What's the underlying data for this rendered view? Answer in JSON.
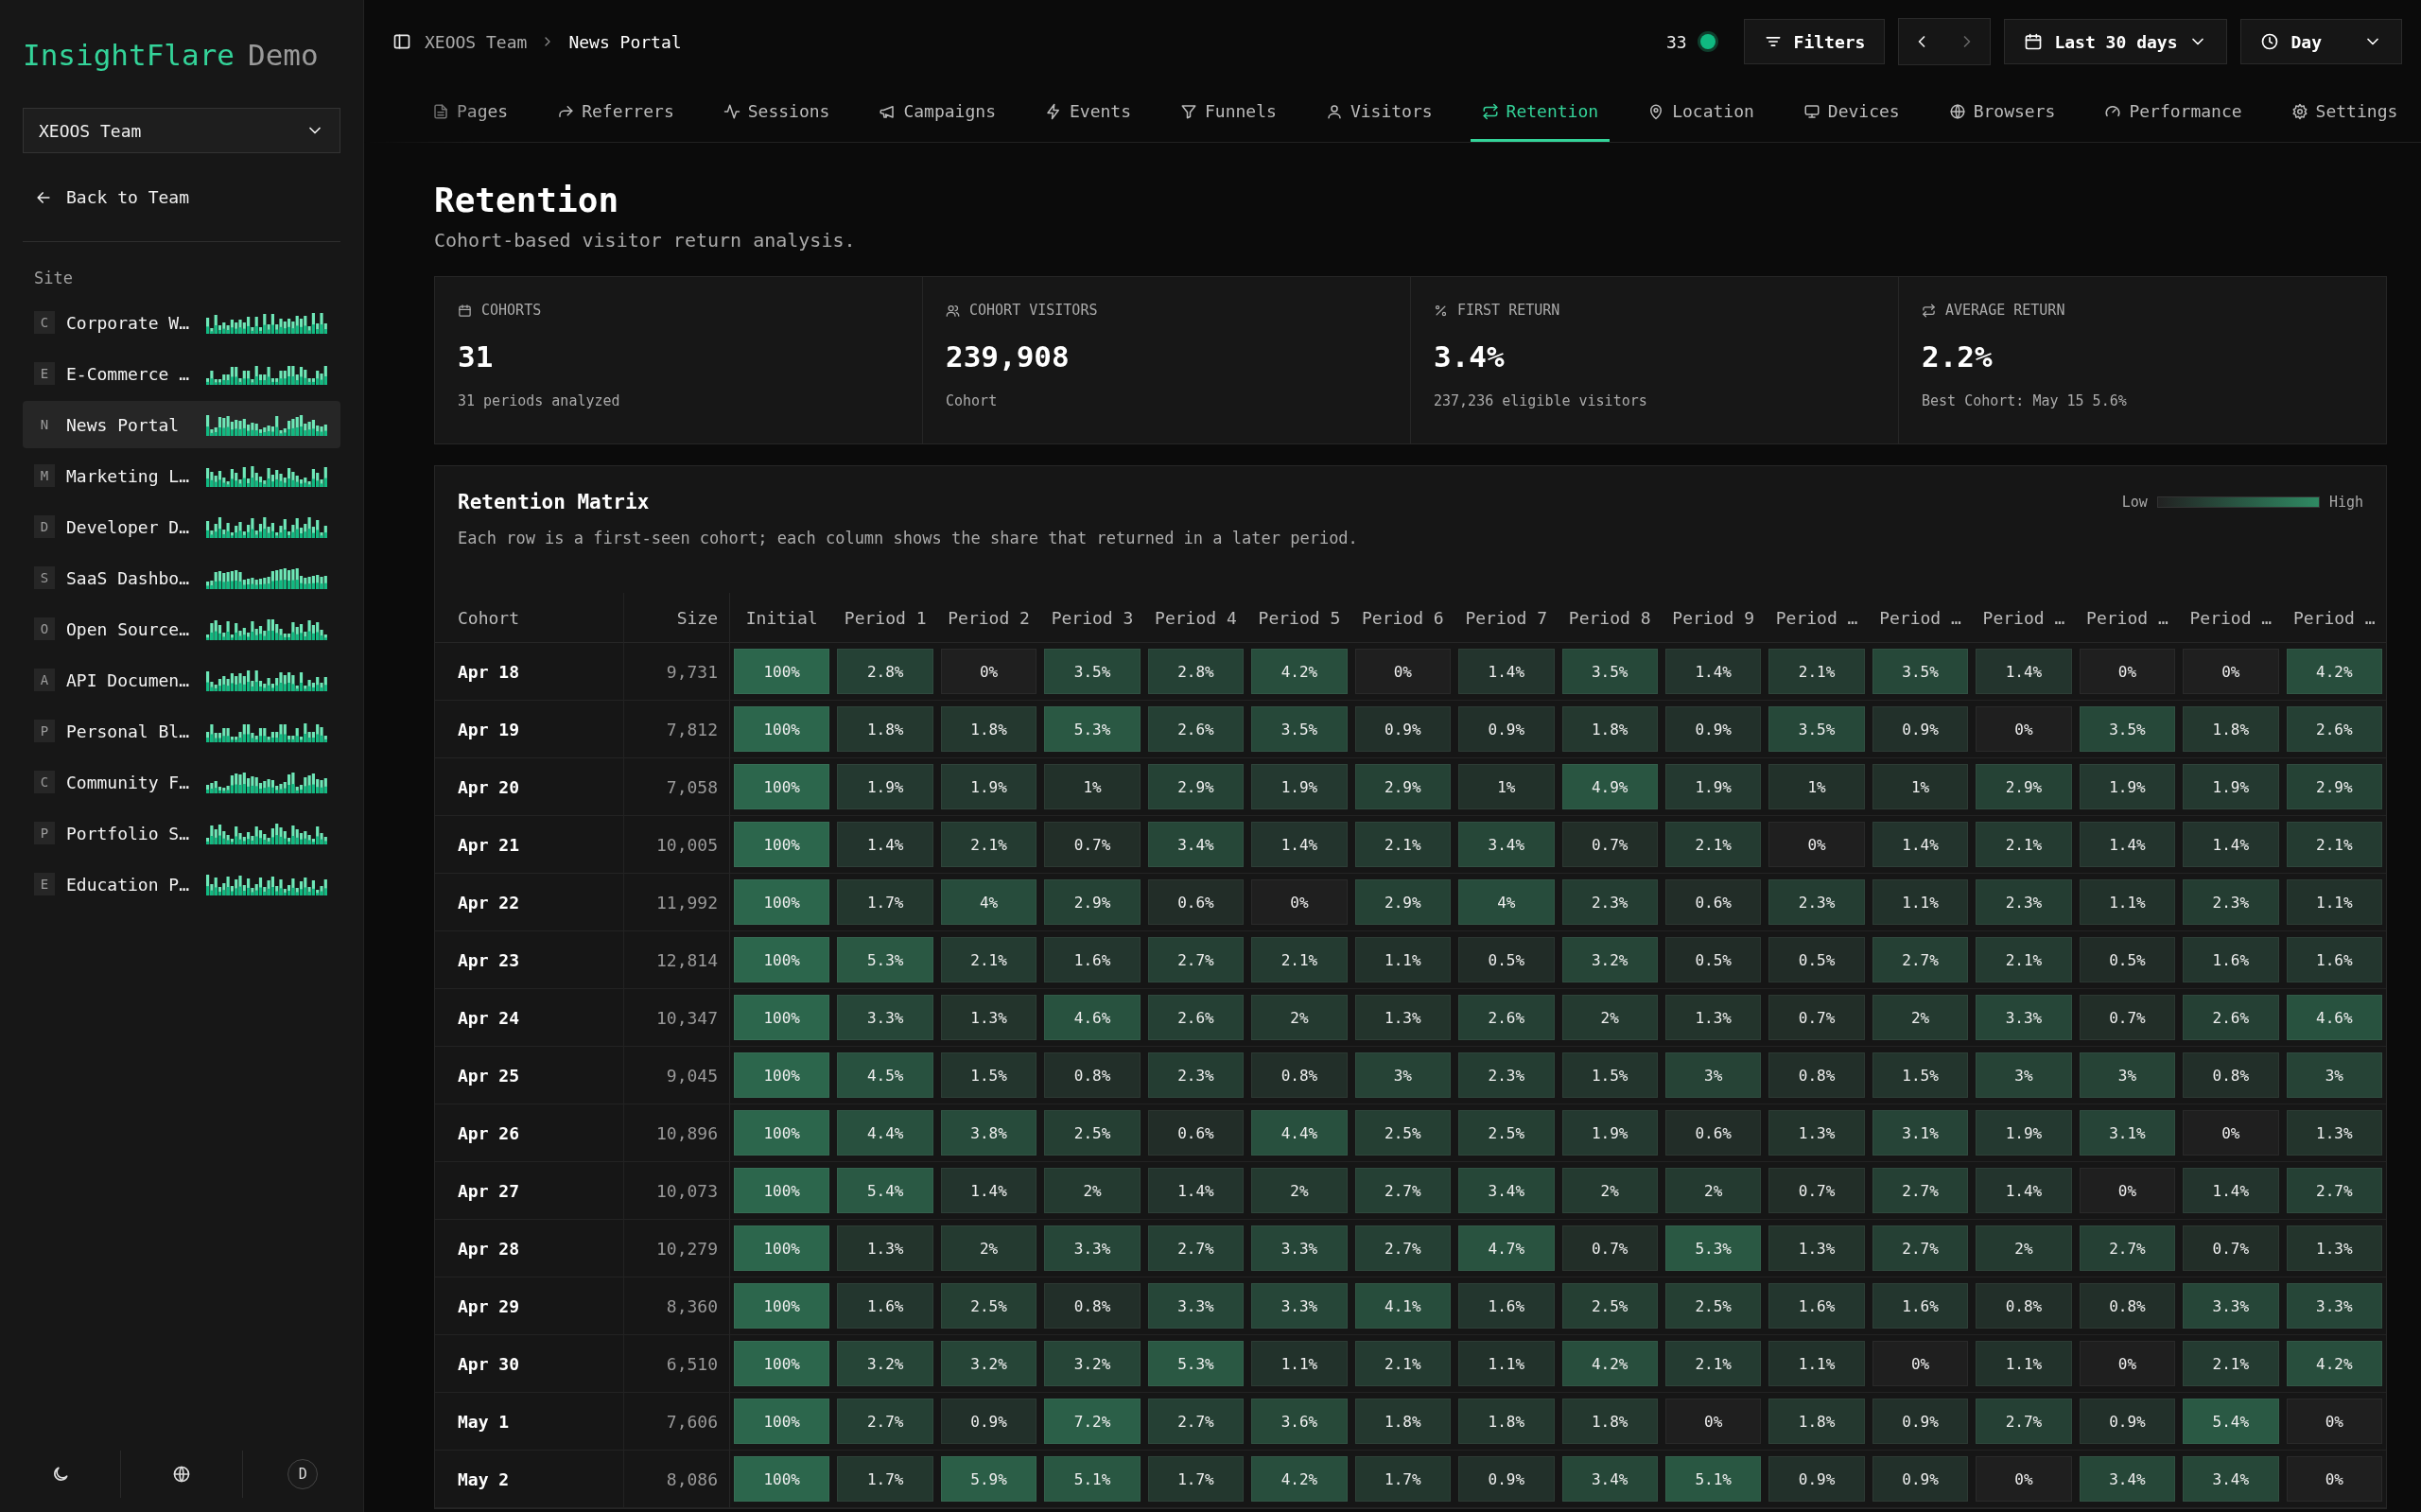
{
  "sidebar": {
    "brand": {
      "name": "InsightFlare",
      "suffix": "Demo"
    },
    "team_select": {
      "value": "XEOOS Team"
    },
    "back_link": "Back to Team",
    "section_label": "Site",
    "sites": [
      {
        "letter": "C",
        "name": "Corporate W…",
        "selected": false
      },
      {
        "letter": "E",
        "name": "E-Commerce …",
        "selected": false
      },
      {
        "letter": "N",
        "name": "News Portal",
        "selected": true
      },
      {
        "letter": "M",
        "name": "Marketing L…",
        "selected": false
      },
      {
        "letter": "D",
        "name": "Developer D…",
        "selected": false
      },
      {
        "letter": "S",
        "name": "SaaS Dashbo…",
        "selected": false
      },
      {
        "letter": "O",
        "name": "Open Source…",
        "selected": false
      },
      {
        "letter": "A",
        "name": "API Documen…",
        "selected": false
      },
      {
        "letter": "P",
        "name": "Personal Bl…",
        "selected": false
      },
      {
        "letter": "C",
        "name": "Community F…",
        "selected": false
      },
      {
        "letter": "P",
        "name": "Portfolio S…",
        "selected": false
      },
      {
        "letter": "E",
        "name": "Education P…",
        "selected": false
      }
    ],
    "footer": {
      "avatar": "D"
    }
  },
  "topbar": {
    "breadcrumb": [
      "XEOOS Team",
      "News Portal"
    ],
    "online_count": "33",
    "filters": "Filters",
    "next_disabled": true,
    "date_range": "Last 30 days",
    "granularity": "Day"
  },
  "tabs": [
    {
      "label": "Pages",
      "selected": false
    },
    {
      "label": "Referrers",
      "selected": false
    },
    {
      "label": "Sessions",
      "selected": false
    },
    {
      "label": "Campaigns",
      "selected": false
    },
    {
      "label": "Events",
      "selected": false
    },
    {
      "label": "Funnels",
      "selected": false
    },
    {
      "label": "Visitors",
      "selected": false
    },
    {
      "label": "Retention",
      "selected": true
    },
    {
      "label": "Location",
      "selected": false
    },
    {
      "label": "Devices",
      "selected": false
    },
    {
      "label": "Browsers",
      "selected": false
    },
    {
      "label": "Performance",
      "selected": false
    },
    {
      "label": "Settings",
      "selected": false
    }
  ],
  "page": {
    "title": "Retention",
    "subtitle": "Cohort-based visitor return analysis."
  },
  "stats": [
    {
      "label": "COHORTS",
      "value": "31",
      "note": "31 periods analyzed"
    },
    {
      "label": "COHORT VISITORS",
      "value": "239,908",
      "note": "Cohort"
    },
    {
      "label": "FIRST RETURN",
      "value": "3.4%",
      "note": "237,236 eligible visitors"
    },
    {
      "label": "AVERAGE RETURN",
      "value": "2.2%",
      "note": "Best Cohort: May 15 5.6%"
    }
  ],
  "matrix": {
    "title": "Retention Matrix",
    "description": "Each row is a first-seen cohort; each column shows the share that returned in a later period.",
    "legend": {
      "low": "Low",
      "high": "High"
    },
    "columns": [
      "Cohort",
      "Size",
      "Initial",
      "Period 1",
      "Period 2",
      "Period 3",
      "Period 4",
      "Period 5",
      "Period 6",
      "Period 7",
      "Period 8",
      "Period 9",
      "Period …",
      "Period …",
      "Period …",
      "Period …",
      "Period …",
      "Period …"
    ],
    "rows": [
      [
        "Apr 18",
        "9,731",
        "100%",
        "2.8%",
        "0%",
        "3.5%",
        "2.8%",
        "4.2%",
        "0%",
        "1.4%",
        "3.5%",
        "1.4%",
        "2.1%",
        "3.5%",
        "1.4%",
        "0%",
        "0%",
        "4.2%"
      ],
      [
        "Apr 19",
        "7,812",
        "100%",
        "1.8%",
        "1.8%",
        "5.3%",
        "2.6%",
        "3.5%",
        "0.9%",
        "0.9%",
        "1.8%",
        "0.9%",
        "3.5%",
        "0.9%",
        "0%",
        "3.5%",
        "1.8%",
        "2.6%"
      ],
      [
        "Apr 20",
        "7,058",
        "100%",
        "1.9%",
        "1.9%",
        "1%",
        "2.9%",
        "1.9%",
        "2.9%",
        "1%",
        "4.9%",
        "1.9%",
        "1%",
        "1%",
        "2.9%",
        "1.9%",
        "1.9%",
        "2.9%"
      ],
      [
        "Apr 21",
        "10,005",
        "100%",
        "1.4%",
        "2.1%",
        "0.7%",
        "3.4%",
        "1.4%",
        "2.1%",
        "3.4%",
        "0.7%",
        "2.1%",
        "0%",
        "1.4%",
        "2.1%",
        "1.4%",
        "1.4%",
        "2.1%"
      ],
      [
        "Apr 22",
        "11,992",
        "100%",
        "1.7%",
        "4%",
        "2.9%",
        "0.6%",
        "0%",
        "2.9%",
        "4%",
        "2.3%",
        "0.6%",
        "2.3%",
        "1.1%",
        "2.3%",
        "1.1%",
        "2.3%",
        "1.1%"
      ],
      [
        "Apr 23",
        "12,814",
        "100%",
        "5.3%",
        "2.1%",
        "1.6%",
        "2.7%",
        "2.1%",
        "1.1%",
        "0.5%",
        "3.2%",
        "0.5%",
        "0.5%",
        "2.7%",
        "2.1%",
        "0.5%",
        "1.6%",
        "1.6%"
      ],
      [
        "Apr 24",
        "10,347",
        "100%",
        "3.3%",
        "1.3%",
        "4.6%",
        "2.6%",
        "2%",
        "1.3%",
        "2.6%",
        "2%",
        "1.3%",
        "0.7%",
        "2%",
        "3.3%",
        "0.7%",
        "2.6%",
        "4.6%"
      ],
      [
        "Apr 25",
        "9,045",
        "100%",
        "4.5%",
        "1.5%",
        "0.8%",
        "2.3%",
        "0.8%",
        "3%",
        "2.3%",
        "1.5%",
        "3%",
        "0.8%",
        "1.5%",
        "3%",
        "3%",
        "0.8%",
        "3%"
      ],
      [
        "Apr 26",
        "10,896",
        "100%",
        "4.4%",
        "3.8%",
        "2.5%",
        "0.6%",
        "4.4%",
        "2.5%",
        "2.5%",
        "1.9%",
        "0.6%",
        "1.3%",
        "3.1%",
        "1.9%",
        "3.1%",
        "0%",
        "1.3%"
      ],
      [
        "Apr 27",
        "10,073",
        "100%",
        "5.4%",
        "1.4%",
        "2%",
        "1.4%",
        "2%",
        "2.7%",
        "3.4%",
        "2%",
        "2%",
        "0.7%",
        "2.7%",
        "1.4%",
        "0%",
        "1.4%",
        "2.7%"
      ],
      [
        "Apr 28",
        "10,279",
        "100%",
        "1.3%",
        "2%",
        "3.3%",
        "2.7%",
        "3.3%",
        "2.7%",
        "4.7%",
        "0.7%",
        "5.3%",
        "1.3%",
        "2.7%",
        "2%",
        "2.7%",
        "0.7%",
        "1.3%"
      ],
      [
        "Apr 29",
        "8,360",
        "100%",
        "1.6%",
        "2.5%",
        "0.8%",
        "3.3%",
        "3.3%",
        "4.1%",
        "1.6%",
        "2.5%",
        "2.5%",
        "1.6%",
        "1.6%",
        "0.8%",
        "0.8%",
        "3.3%",
        "3.3%"
      ],
      [
        "Apr 30",
        "6,510",
        "100%",
        "3.2%",
        "3.2%",
        "3.2%",
        "5.3%",
        "1.1%",
        "2.1%",
        "1.1%",
        "4.2%",
        "2.1%",
        "1.1%",
        "0%",
        "1.1%",
        "0%",
        "2.1%",
        "4.2%"
      ],
      [
        "May 1",
        "7,606",
        "100%",
        "2.7%",
        "0.9%",
        "7.2%",
        "2.7%",
        "3.6%",
        "1.8%",
        "1.8%",
        "1.8%",
        "0%",
        "1.8%",
        "0.9%",
        "2.7%",
        "0.9%",
        "5.4%",
        "0%"
      ],
      [
        "May 2",
        "8,086",
        "100%",
        "1.7%",
        "5.9%",
        "5.1%",
        "1.7%",
        "4.2%",
        "1.7%",
        "0.9%",
        "3.4%",
        "5.1%",
        "0.9%",
        "0.9%",
        "0%",
        "3.4%",
        "3.4%",
        "0%"
      ]
    ]
  }
}
